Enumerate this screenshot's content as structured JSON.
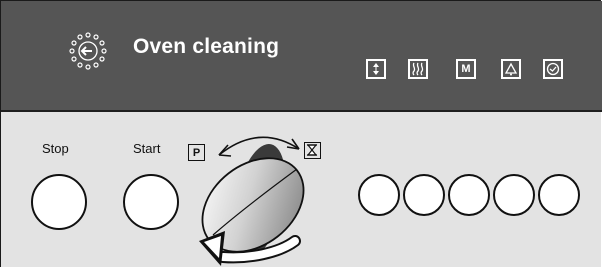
{
  "display": {
    "title": "Oven cleaning",
    "title_icon": "oven-cleaning-sun-arrow-icon",
    "symbols": [
      {
        "name": "up-down-arrows-icon",
        "glyph": "↕"
      },
      {
        "name": "heat-waves-icon",
        "glyph": "♨"
      },
      {
        "name": "m-memory-icon",
        "glyph": "M"
      },
      {
        "name": "bell-alarm-icon",
        "glyph": "⍾"
      },
      {
        "name": "clock-icon",
        "glyph": "◷"
      }
    ]
  },
  "controls": {
    "stop_label": "Stop",
    "start_label": "Start",
    "p_label": "P"
  },
  "colors": {
    "display_bg": "#555555",
    "panel_bg": "#e3e3e3"
  }
}
